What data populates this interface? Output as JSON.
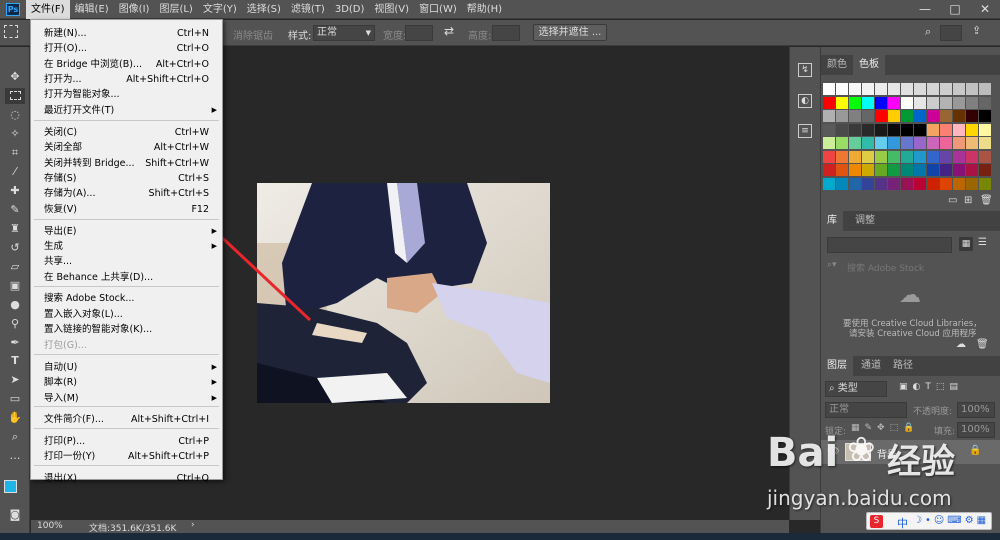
{
  "app": {
    "logo_text": "Ps"
  },
  "menubar": {
    "items": [
      "文件(F)",
      "编辑(E)",
      "图像(I)",
      "图层(L)",
      "文字(Y)",
      "选择(S)",
      "滤镜(T)",
      "3D(D)",
      "视图(V)",
      "窗口(W)",
      "帮助(H)"
    ],
    "window_controls": [
      "—",
      "□",
      "✕"
    ]
  },
  "options_bar": {
    "feather_label": "消除锯齿",
    "style_label": "样式:",
    "style_value": "正常",
    "width_label": "宽度:",
    "height_label": "高度:",
    "select_mask_button": "选择并遮住 ..."
  },
  "file_menu": {
    "items": [
      {
        "label": "新建(N)...",
        "shortcut": "Ctrl+N"
      },
      {
        "label": "打开(O)...",
        "shortcut": "Ctrl+O"
      },
      {
        "label": "在 Bridge 中浏览(B)...",
        "shortcut": "Alt+Ctrl+O"
      },
      {
        "label": "打开为...",
        "shortcut": "Alt+Shift+Ctrl+O"
      },
      {
        "label": "打开为智能对象...",
        "shortcut": ""
      },
      {
        "label": "最近打开文件(T)",
        "shortcut": "",
        "submenu": true
      },
      {
        "label": "关闭(C)",
        "shortcut": "Ctrl+W"
      },
      {
        "label": "关闭全部",
        "shortcut": "Alt+Ctrl+W"
      },
      {
        "label": "关闭并转到 Bridge...",
        "shortcut": "Shift+Ctrl+W"
      },
      {
        "label": "存储(S)",
        "shortcut": "Ctrl+S"
      },
      {
        "label": "存储为(A)...",
        "shortcut": "Shift+Ctrl+S"
      },
      {
        "label": "恢复(V)",
        "shortcut": "F12"
      },
      {
        "label": "导出(E)",
        "shortcut": "",
        "submenu": true
      },
      {
        "label": "生成",
        "shortcut": "",
        "submenu": true
      },
      {
        "label": "共享...",
        "shortcut": ""
      },
      {
        "label": "在 Behance 上共享(D)...",
        "shortcut": ""
      },
      {
        "label": "搜索 Adobe Stock...",
        "shortcut": ""
      },
      {
        "label": "置入嵌入对象(L)...",
        "shortcut": ""
      },
      {
        "label": "置入链接的智能对象(K)...",
        "shortcut": ""
      },
      {
        "label": "打包(G)...",
        "shortcut": "",
        "disabled": true
      },
      {
        "label": "自动(U)",
        "shortcut": "",
        "submenu": true
      },
      {
        "label": "脚本(R)",
        "shortcut": "",
        "submenu": true
      },
      {
        "label": "导入(M)",
        "shortcut": "",
        "submenu": true
      },
      {
        "label": "文件简介(F)...",
        "shortcut": "Alt+Shift+Ctrl+I"
      },
      {
        "label": "打印(P)...",
        "shortcut": "Ctrl+P"
      },
      {
        "label": "打印一份(Y)",
        "shortcut": "Alt+Shift+Ctrl+P"
      },
      {
        "label": "退出(X)",
        "shortcut": "Ctrl+Q"
      }
    ]
  },
  "swatch_panel": {
    "tabs": [
      "颜色",
      "色板"
    ],
    "active_tab": "色板"
  },
  "library_panel": {
    "tabs": [
      "库",
      "调整"
    ],
    "search_placeholder": "搜索 Adobe Stock",
    "message_line1": "要使用 Creative Cloud Libraries，",
    "message_line2": "请安装 Creative Cloud 应用程序"
  },
  "layers_panel": {
    "tabs": [
      "图层",
      "通道",
      "路径"
    ],
    "filter_label": "类型",
    "blend_mode": "正常",
    "opacity_label": "不透明度:",
    "opacity_value": "100%",
    "lock_label": "锁定:",
    "fill_label": "填充:",
    "fill_value": "100%",
    "layer_name": "背景"
  },
  "status": {
    "zoom": "100%",
    "doc_info": "文档:351.6K/351.6K"
  },
  "watermark": {
    "brand": "Bai",
    "brand2": "经验",
    "url": "jingyan.baidu.com"
  },
  "ime": {
    "lang": "中"
  },
  "colors": {
    "annotation_arrow": "#e8262b",
    "menu_bg": "#f0f0f0",
    "ui_bg": "#535353",
    "canvas_bg": "#282828"
  }
}
